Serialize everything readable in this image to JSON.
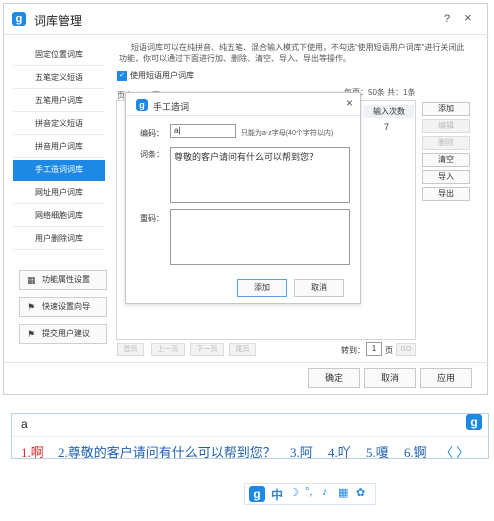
{
  "app": {
    "logo_glyph": "g",
    "title": "词库管理"
  },
  "window_controls": {
    "help": "?",
    "close": "×"
  },
  "sidebar": {
    "items": [
      {
        "label": "固定位置词库"
      },
      {
        "label": "五笔定义短语"
      },
      {
        "label": "五笔用户词库"
      },
      {
        "label": "拼音定义短语"
      },
      {
        "label": "拼音用户词库"
      },
      {
        "label": "手工造词词库",
        "active": true
      },
      {
        "label": "网址用户词库"
      },
      {
        "label": "网络细胞词库"
      },
      {
        "label": "用户删除词库"
      }
    ],
    "buttons": [
      {
        "label": "功能属性设置",
        "icon": "grid-icon"
      },
      {
        "label": "快速设置向导",
        "icon": "flag-icon"
      },
      {
        "label": "提交用户建议",
        "icon": "flag-icon"
      }
    ]
  },
  "main": {
    "description": "短语词库可以在纯拼音、纯五笔、混合输入模式下使用，不勾选“使用短语用户词库”进行关闭此功能，你可以通过下面进行加、删除、清空、导入、导出等操作。",
    "checkbox_label": "使用短语用户词库",
    "checkbox_checked": true,
    "page_label": "页次：1/1页",
    "page_stats": "每页：50条 共：1条",
    "col_header": "输入次数",
    "row_value": "7",
    "actions": [
      {
        "label": "添加",
        "enabled": true
      },
      {
        "label": "编辑",
        "enabled": false
      },
      {
        "label": "删除",
        "enabled": false
      },
      {
        "label": "清空",
        "enabled": true
      },
      {
        "label": "导入",
        "enabled": true
      },
      {
        "label": "导出",
        "enabled": true
      }
    ],
    "pager": {
      "first": "首页",
      "prev": "上一页",
      "next": "下一页",
      "last": "尾页",
      "goto_label": "转到：",
      "page_value": "1",
      "page_unit": "页",
      "go": "GO"
    }
  },
  "footer": {
    "ok": "确定",
    "cancel": "取消",
    "apply": "应用"
  },
  "dialog": {
    "title": "手工造词",
    "close": "×",
    "code_label": "编码：",
    "code_value": "a",
    "code_hint": "只能为a-z字母(40个字符以内)",
    "entry_label": "词条：",
    "entry_value": "尊敬的客户请问有什么可以帮到您？",
    "weight_label": "重码：",
    "weight_value": "",
    "add": "添加",
    "cancel": "取消"
  },
  "ime": {
    "input": "a",
    "candidates": [
      "1.啊",
      "2.尊敬的客户请问有什么可以帮到您？",
      "3.阿",
      "4.吖",
      "5.嗄",
      "6.锕"
    ],
    "page_nav": "〈 〉"
  },
  "status_bar": {
    "lang": "中"
  },
  "colors": {
    "accent": "#1e88e5",
    "first_candidate": "#d62b2b",
    "candidate": "#1e5fb4"
  }
}
